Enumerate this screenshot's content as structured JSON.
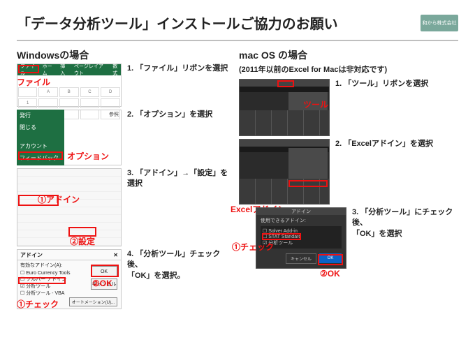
{
  "header": {
    "title": "「データ分析ツール」インストールご協力のお願い",
    "logo_text": "和から株式会社"
  },
  "windows": {
    "heading": "Windowsの場合",
    "steps": {
      "s1": "1. 「ファイル」リボンを選択",
      "s2": "2. 「オプション」を選択",
      "s3": "3. 「アドイン」→「設定」を選択",
      "s4": "4. 「分析ツール」チェック後、\n        「OK」を選択。"
    },
    "ribbon": {
      "file": "ファイル",
      "home": "ホーム",
      "insert": "挿入",
      "layout": "ページレイアウト",
      "formula": "数式"
    },
    "callouts": {
      "file": "ファイル",
      "option": "オプション",
      "addin": "①アドイン",
      "settei": "②設定",
      "check": "①チェック",
      "ok": "②OK"
    },
    "opt_panel": {
      "publish": "発行",
      "close": "閉じる",
      "account": "アカウント",
      "feedback": "フィードバック",
      "option": "オプション",
      "ref": "参照"
    },
    "addin_dialog": {
      "title": "アドイン",
      "close": "✕",
      "label": "有効なアドイン(A):",
      "item1": "Euro Currency Tools",
      "item2": "ソルバー アドイン",
      "item3": "分析ツール",
      "item4": "分析ツール - VBA",
      "ok": "OK",
      "cancel": "キャンセル",
      "auto": "オートメーション(U)..."
    }
  },
  "mac": {
    "heading": "mac OS の場合",
    "subheading": "(2011年以前のExcel for Macは非対応です)",
    "steps": {
      "s1": "1. 「ツール」リボンを選択",
      "s2": "2. 「Excelアドイン」を選択",
      "s3": "3. 「分析ツール」にチェック後、\n       「OK」を選択"
    },
    "callouts": {
      "tool": "ツール",
      "excel_addin": "Excelアドイン",
      "check": "①チェック",
      "ok": "②OK"
    },
    "dialog": {
      "title": "アドイン",
      "avail": "使用できるアドイン:",
      "i1": "Solver Add-in",
      "i2": "STAT Standard",
      "i3": "分析ツール",
      "cancel": "キャンセル",
      "ok": "OK"
    }
  }
}
